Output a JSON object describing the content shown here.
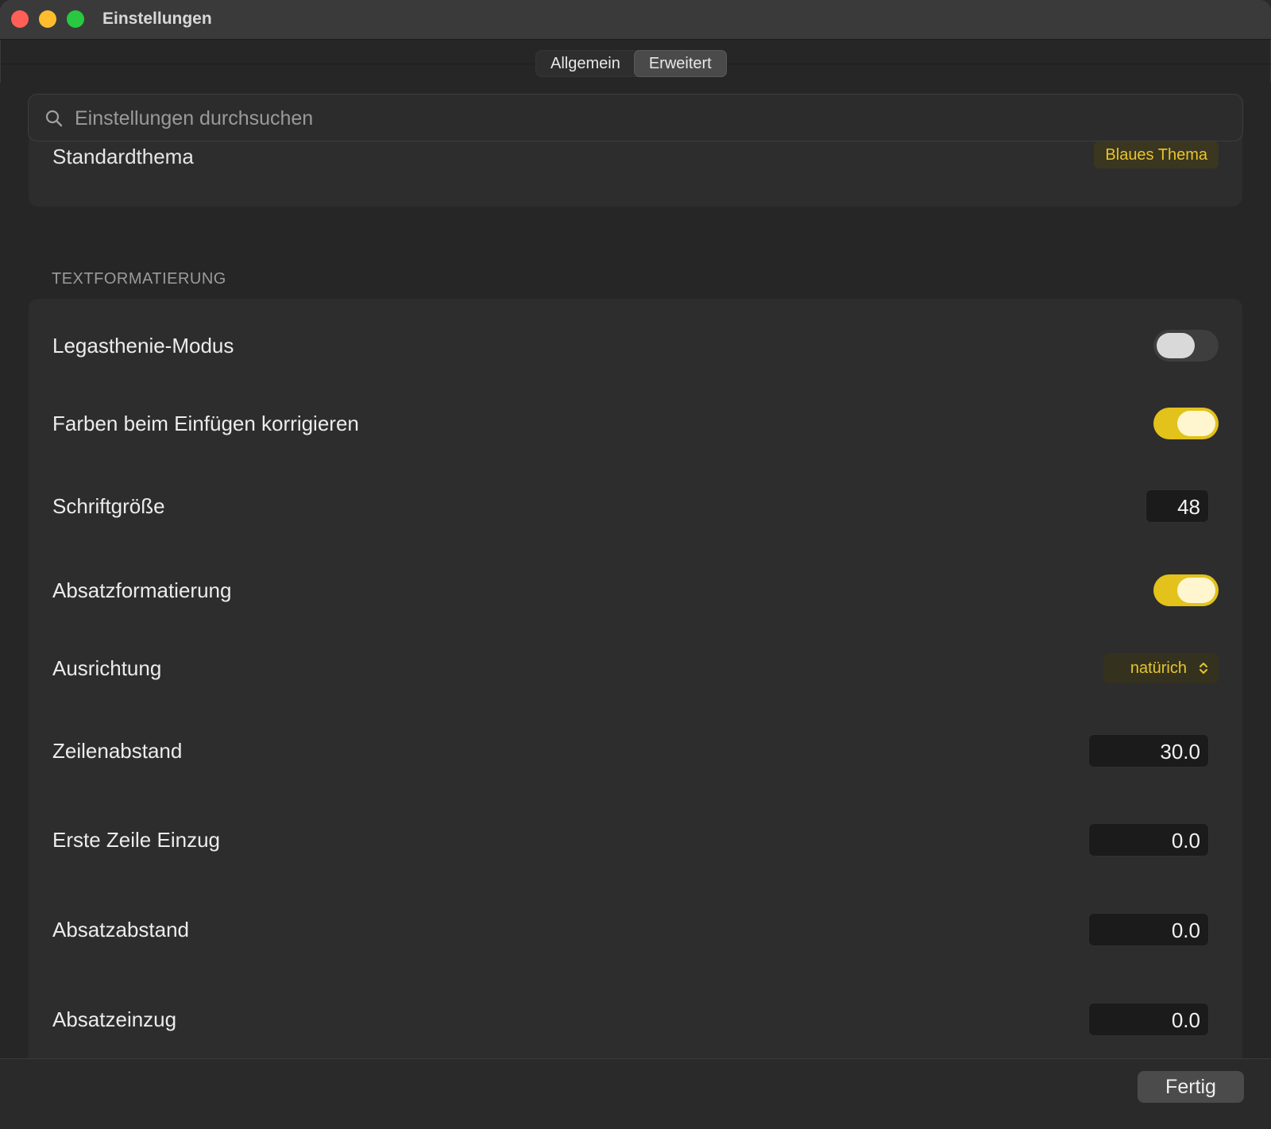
{
  "window": {
    "title": "Einstellungen"
  },
  "tabs": [
    {
      "label": "Allgemein",
      "active": false
    },
    {
      "label": "Erweitert",
      "active": true
    }
  ],
  "search": {
    "placeholder": "Einstellungen durchsuchen",
    "value": ""
  },
  "previous_card": {
    "label": "Standardthema",
    "popup_value": "Blaues Thema"
  },
  "section": {
    "title": "TEXTFORMATIERUNG",
    "rows": {
      "dyslexia": {
        "label": "Legasthenie-Modus",
        "enabled": false
      },
      "fix_colors": {
        "label": "Farben beim Einfügen korrigieren",
        "enabled": true
      },
      "font_size": {
        "label": "Schriftgröße",
        "value": "48"
      },
      "paragraph_format": {
        "label": "Absatzformatierung",
        "enabled": true
      },
      "alignment": {
        "label": "Ausrichtung",
        "value": "natürich"
      },
      "line_spacing": {
        "label": "Zeilenabstand",
        "value": "30.0"
      },
      "first_line_indent": {
        "label": "Erste Zeile Einzug",
        "value": "0.0"
      },
      "paragraph_spacing": {
        "label": "Absatzabstand",
        "value": "0.0"
      },
      "paragraph_indent": {
        "label": "Absatzeinzug",
        "value": "0.0"
      }
    }
  },
  "footer": {
    "done_label": "Fertig"
  },
  "colors": {
    "accent": "#e2c21b",
    "background": "#262626",
    "card": "#2d2d2d"
  }
}
